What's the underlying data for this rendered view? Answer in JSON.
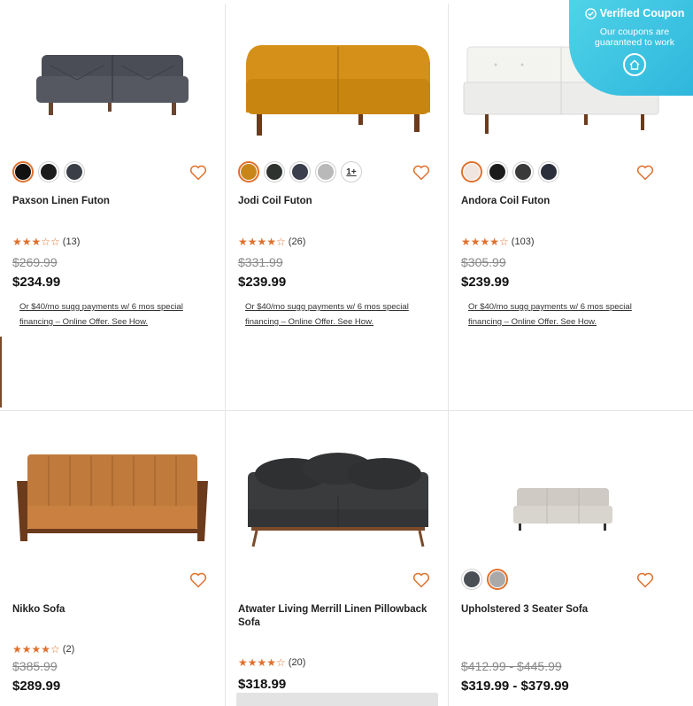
{
  "coupon": {
    "title": "Verified Coupon",
    "subtitle": "Our coupons are guaranteed to work"
  },
  "products": [
    {
      "name": "Paxson Linen Futon",
      "swatches": [
        "#111111",
        "#1c1c1c",
        "#3a3f47"
      ],
      "selected_swatch": 0,
      "stars": "★★★☆☆",
      "rating_count": "(13)",
      "was_price": "$269.99",
      "price": "$234.99",
      "finance": "Or $40/mo sugg payments w/ 6 mos special financing – Online Offer. See How."
    },
    {
      "name": "Jodi Coil Futon",
      "swatches": [
        "#c8861a",
        "#2f332f",
        "#3b3e4c",
        "#b9b9b9"
      ],
      "more_swatches": "1+",
      "selected_swatch": 0,
      "stars": "★★★★☆",
      "rating_count": "(26)",
      "was_price": "$331.99",
      "price": "$239.99",
      "finance": "Or $40/mo sugg payments w/ 6 mos special financing – Online Offer. See How."
    },
    {
      "name": "Andora Coil Futon",
      "swatches": [
        "#f1e6df",
        "#1b1b1b",
        "#3a3a3a",
        "#2a2f3b"
      ],
      "selected_swatch": 0,
      "stars": "★★★★☆",
      "rating_count": "(103)",
      "was_price": "$305.99",
      "price": "$239.99",
      "finance": "Or $40/mo sugg payments w/ 6 mos special financing – Online Offer. See How."
    },
    {
      "name": "Nikko Sofa",
      "stars": "★★★★☆",
      "rating_count": "(2)",
      "was_price": "$385.99",
      "price": "$289.99"
    },
    {
      "name": "Atwater Living Merrill Linen Pillowback Sofa",
      "stars": "★★★★☆",
      "rating_count": "(20)",
      "price": "$318.99"
    },
    {
      "name": "Upholstered 3 Seater Sofa",
      "swatches": [
        "#4a4e55",
        "#a9a9a9"
      ],
      "selected_swatch": 1,
      "was_price": "$412.99 - $445.99",
      "price": "$319.99 - $379.99"
    }
  ]
}
